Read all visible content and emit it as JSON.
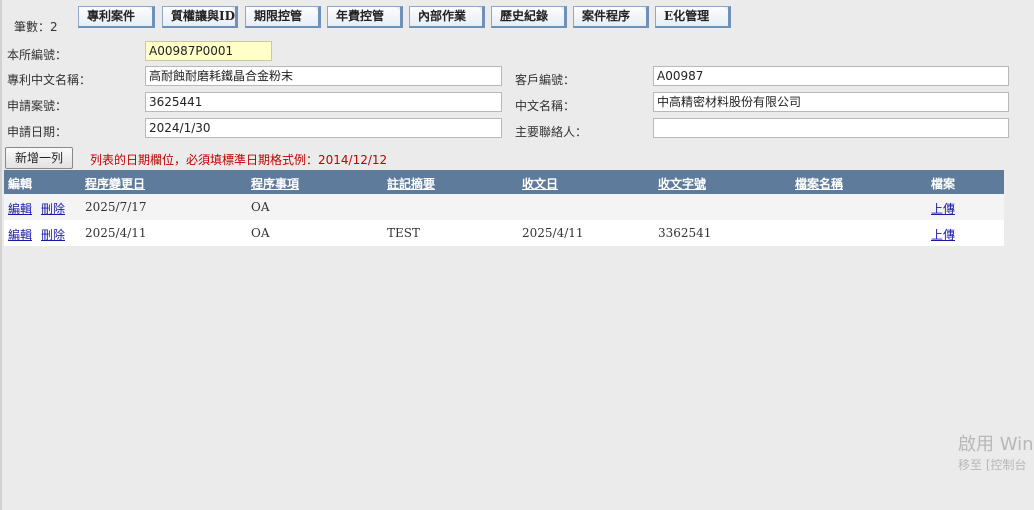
{
  "record_count": {
    "label": "筆數：",
    "value": "2"
  },
  "tabs": [
    {
      "label": "專利案件"
    },
    {
      "label": "質權讓與IDS"
    },
    {
      "label": "期限控管"
    },
    {
      "label": "年費控管"
    },
    {
      "label": "內部作業"
    },
    {
      "label": "歷史紀錄"
    },
    {
      "label": "案件程序"
    },
    {
      "label": "E化管理"
    }
  ],
  "form": {
    "our_no_label": "本所編號：",
    "our_no_value": "A00987P0001",
    "title_cn_label": "專利中文名稱：",
    "title_cn_value": "高耐蝕耐磨耗鐵晶合金粉末",
    "app_no_label": "申請案號：",
    "app_no_value": "3625441",
    "app_date_label": "申請日期：",
    "app_date_value": "2024/1/30",
    "client_no_label": "客戶編號：",
    "client_no_value": "A00987",
    "client_name_label": "中文名稱：",
    "client_name_value": "中高精密材料股份有限公司",
    "contact_label": "主要聯絡人：",
    "contact_value": ""
  },
  "toolbar": {
    "add_row_label": "新增一列",
    "notice": "列表的日期欄位，必須填標準日期格式例：2014/12/12"
  },
  "grid": {
    "headers": [
      "編輯",
      "程序變更日",
      "程序事項",
      "註記摘要",
      "收文日",
      "收文字號",
      "檔案名稱",
      "檔案"
    ],
    "edit_label": "編輯",
    "delete_label": "刪除",
    "upload_label": "上傳",
    "rows": [
      {
        "date": "2025/7/17",
        "item": "OA",
        "note": "",
        "recv_date": "",
        "recv_no": "",
        "file_name": ""
      },
      {
        "date": "2025/4/11",
        "item": "OA",
        "note": "TEST",
        "recv_date": "2025/4/11",
        "recv_no": "3362541",
        "file_name": ""
      }
    ]
  },
  "watermark": {
    "line1": "啟用 Win",
    "line2": "移至 [控制台"
  }
}
